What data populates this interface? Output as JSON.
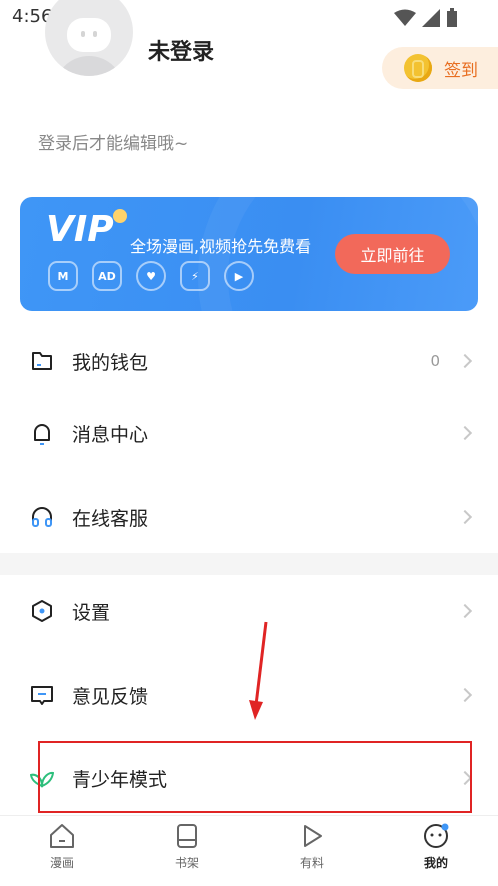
{
  "status_bar": {
    "time": "4:56"
  },
  "profile": {
    "username": "未登录",
    "login_hint": "登录后才能编辑哦~",
    "checkin_label": "签到"
  },
  "vip": {
    "logo": "VIP",
    "text": "全场漫画,视频抢先免费看",
    "button": "立即前往",
    "perks": [
      "M",
      "AD",
      "♥",
      "⚡",
      "▶"
    ]
  },
  "menu": {
    "wallet": {
      "label": "我的钱包",
      "value": "0"
    },
    "messages": {
      "label": "消息中心"
    },
    "support": {
      "label": "在线客服"
    },
    "settings": {
      "label": "设置"
    },
    "feedback": {
      "label": "意见反馈"
    },
    "youth_mode": {
      "label": "青少年模式"
    }
  },
  "tabs": [
    {
      "label": "漫画"
    },
    {
      "label": "书架"
    },
    {
      "label": "有料"
    },
    {
      "label": "我的"
    }
  ],
  "colors": {
    "accent": "#3f96f6",
    "vip_button": "#f2695a",
    "highlight": "#e02424"
  }
}
